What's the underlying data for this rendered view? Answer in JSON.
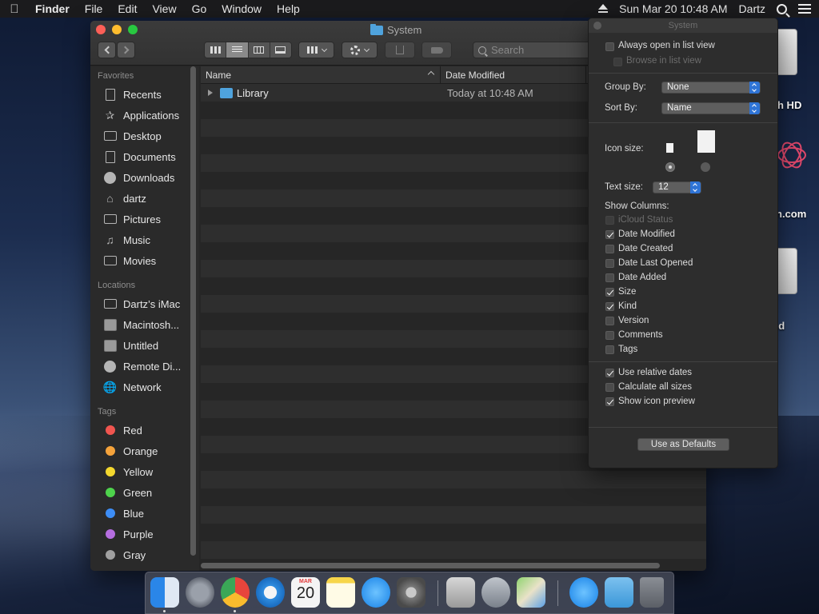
{
  "menubar": {
    "app_name": "Finder",
    "menus": [
      "File",
      "Edit",
      "View",
      "Go",
      "Window",
      "Help"
    ],
    "clock": "Sun Mar 20  10:48 AM",
    "user": "Dartz"
  },
  "window": {
    "title": "System",
    "search_placeholder": "Search"
  },
  "sidebar": {
    "favorites_heading": "Favorites",
    "favorites": [
      {
        "label": "Recents",
        "icon": "recents-icon"
      },
      {
        "label": "Applications",
        "icon": "applications-icon"
      },
      {
        "label": "Desktop",
        "icon": "desktop-icon"
      },
      {
        "label": "Documents",
        "icon": "documents-icon"
      },
      {
        "label": "Downloads",
        "icon": "downloads-icon"
      },
      {
        "label": "dartz",
        "icon": "home-icon"
      },
      {
        "label": "Pictures",
        "icon": "pictures-icon"
      },
      {
        "label": "Music",
        "icon": "music-icon"
      },
      {
        "label": "Movies",
        "icon": "movies-icon"
      }
    ],
    "locations_heading": "Locations",
    "locations": [
      {
        "label": "Dartz’s iMac",
        "icon": "imac-icon"
      },
      {
        "label": "Macintosh...",
        "icon": "disk-icon"
      },
      {
        "label": "Untitled",
        "icon": "disk-icon"
      },
      {
        "label": "Remote Di...",
        "icon": "remote-disc-icon"
      },
      {
        "label": "Network",
        "icon": "network-icon"
      }
    ],
    "tags_heading": "Tags",
    "tags": [
      {
        "label": "Red",
        "color": "#f0554f"
      },
      {
        "label": "Orange",
        "color": "#f5a33b"
      },
      {
        "label": "Yellow",
        "color": "#f4d82e"
      },
      {
        "label": "Green",
        "color": "#4ed34c"
      },
      {
        "label": "Blue",
        "color": "#3d8df5"
      },
      {
        "label": "Purple",
        "color": "#b66ee0"
      },
      {
        "label": "Gray",
        "color": "#a0a0a0"
      }
    ]
  },
  "file_list": {
    "columns": [
      "Name",
      "Date Modified"
    ],
    "rows": [
      {
        "name": "Library",
        "date_modified": "Today at 10:48 AM"
      }
    ]
  },
  "view_options": {
    "title": "System",
    "always_open_in_list_view": {
      "label": "Always open in list view",
      "checked": false
    },
    "browse_in_list_view": {
      "label": "Browse in list view",
      "checked": false,
      "enabled": false
    },
    "group_by_label": "Group By:",
    "group_by_value": "None",
    "sort_by_label": "Sort By:",
    "sort_by_value": "Name",
    "icon_size_label": "Icon size:",
    "text_size_label": "Text size:",
    "text_size_value": "12",
    "show_columns_label": "Show Columns:",
    "columns": [
      {
        "label": "iCloud Status",
        "checked": false,
        "enabled": false
      },
      {
        "label": "Date Modified",
        "checked": true,
        "enabled": true
      },
      {
        "label": "Date Created",
        "checked": false,
        "enabled": true
      },
      {
        "label": "Date Last Opened",
        "checked": false,
        "enabled": true
      },
      {
        "label": "Date Added",
        "checked": false,
        "enabled": true
      },
      {
        "label": "Size",
        "checked": true,
        "enabled": true
      },
      {
        "label": "Kind",
        "checked": true,
        "enabled": true
      },
      {
        "label": "Version",
        "checked": false,
        "enabled": true
      },
      {
        "label": "Comments",
        "checked": false,
        "enabled": true
      },
      {
        "label": "Tags",
        "checked": false,
        "enabled": true
      }
    ],
    "options": [
      {
        "label": "Use relative dates",
        "checked": true
      },
      {
        "label": "Calculate all sizes",
        "checked": false
      },
      {
        "label": "Show icon preview",
        "checked": true
      }
    ],
    "defaults_button": "Use as Defaults"
  },
  "desktop": {
    "labels": [
      "h HD",
      "n.com",
      "ed"
    ]
  },
  "dock": {
    "calendar_month": "MAR",
    "calendar_day": "20",
    "items": [
      "finder-icon",
      "launchpad-icon",
      "chrome-icon",
      "safari-icon",
      "calendar-icon",
      "notes-icon",
      "app-store-icon",
      "system-preferences-icon",
      "disk-utility-icon",
      "directory-utility-icon",
      "maps-icon",
      "app-store-download-icon",
      "downloads-folder-icon",
      "trash-icon"
    ]
  }
}
